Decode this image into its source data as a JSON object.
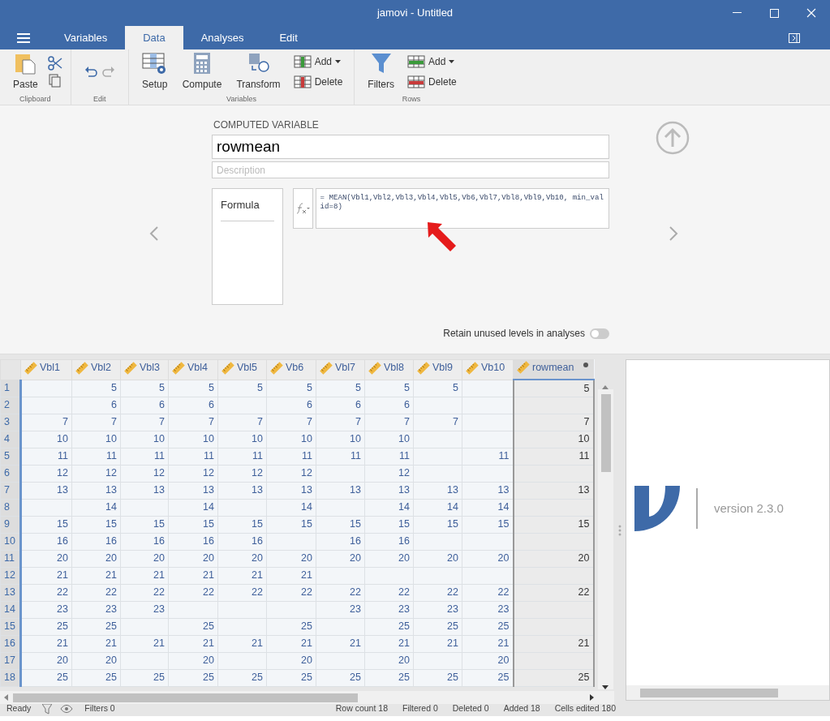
{
  "window": {
    "title": "jamovi - Untitled"
  },
  "tabs": [
    {
      "label": "Variables",
      "selected": false
    },
    {
      "label": "Data",
      "selected": true
    },
    {
      "label": "Analyses",
      "selected": false
    },
    {
      "label": "Edit",
      "selected": false
    }
  ],
  "ribbon": [
    {
      "label": "Clipboard",
      "items": [
        {
          "kind": "paste",
          "label": "Paste"
        },
        {
          "kind": "cutcopy"
        }
      ]
    },
    {
      "label": "Edit",
      "items": [
        {
          "kind": "undoredo"
        }
      ]
    },
    {
      "label": "Variables",
      "items": [
        {
          "kind": "setup",
          "label": "Setup"
        },
        {
          "kind": "compute",
          "label": "Compute"
        },
        {
          "kind": "transform",
          "label": "Transform"
        },
        {
          "kind": "addcol",
          "label": "Add",
          "delete_label": "Delete"
        }
      ]
    },
    {
      "label": "Rows",
      "items": [
        {
          "kind": "filters",
          "label": "Filters"
        },
        {
          "kind": "addrow",
          "label": "Add",
          "delete_label": "Delete"
        }
      ]
    }
  ],
  "computed": {
    "heading": "COMPUTED VARIABLE",
    "name": "rowmean",
    "description": {
      "placeholder": "Description"
    },
    "formula_tab": "Formula",
    "formula": "= MEAN(Vbl1,Vbl2,Vbl3,Vbl4,Vbl5,Vb6,Vbl7,Vbl8,Vbl9,Vb10, min_valid=8)",
    "retain": {
      "label": "Retain unused levels in analyses",
      "on": false
    }
  },
  "grid": {
    "columns": [
      {
        "name": "Vbl1",
        "computed": false,
        "selected": false
      },
      {
        "name": "Vbl2",
        "computed": false,
        "selected": false
      },
      {
        "name": "Vbl3",
        "computed": false,
        "selected": false
      },
      {
        "name": "Vbl4",
        "computed": false,
        "selected": false
      },
      {
        "name": "Vbl5",
        "computed": false,
        "selected": false
      },
      {
        "name": "Vb6",
        "computed": false,
        "selected": false
      },
      {
        "name": "Vbl7",
        "computed": false,
        "selected": false
      },
      {
        "name": "Vbl8",
        "computed": false,
        "selected": false
      },
      {
        "name": "Vbl9",
        "computed": false,
        "selected": false
      },
      {
        "name": "Vb10",
        "computed": false,
        "selected": false
      },
      {
        "name": "rowmean",
        "computed": true,
        "selected": true
      }
    ],
    "rows": [
      {
        "n": "1",
        "cells": [
          "",
          "5",
          "5",
          "5",
          "5",
          "5",
          "5",
          "5",
          "5",
          "",
          "5"
        ]
      },
      {
        "n": "2",
        "cells": [
          "",
          "6",
          "6",
          "6",
          "",
          "6",
          "6",
          "6",
          "",
          "",
          ""
        ]
      },
      {
        "n": "3",
        "cells": [
          "7",
          "7",
          "7",
          "7",
          "7",
          "7",
          "7",
          "7",
          "7",
          "",
          "7"
        ]
      },
      {
        "n": "4",
        "cells": [
          "10",
          "10",
          "10",
          "10",
          "10",
          "10",
          "10",
          "10",
          "",
          "",
          "10"
        ]
      },
      {
        "n": "5",
        "cells": [
          "11",
          "11",
          "11",
          "11",
          "11",
          "11",
          "11",
          "11",
          "",
          "11",
          "11"
        ]
      },
      {
        "n": "6",
        "cells": [
          "12",
          "12",
          "12",
          "12",
          "12",
          "12",
          "",
          "12",
          "",
          "",
          ""
        ]
      },
      {
        "n": "7",
        "cells": [
          "13",
          "13",
          "13",
          "13",
          "13",
          "13",
          "13",
          "13",
          "13",
          "13",
          "13"
        ]
      },
      {
        "n": "8",
        "cells": [
          "",
          "14",
          "",
          "14",
          "",
          "14",
          "",
          "14",
          "14",
          "14",
          ""
        ]
      },
      {
        "n": "9",
        "cells": [
          "15",
          "15",
          "15",
          "15",
          "15",
          "15",
          "15",
          "15",
          "15",
          "15",
          "15"
        ]
      },
      {
        "n": "10",
        "cells": [
          "16",
          "16",
          "16",
          "16",
          "16",
          "",
          "16",
          "16",
          "",
          "",
          ""
        ]
      },
      {
        "n": "11",
        "cells": [
          "20",
          "20",
          "20",
          "20",
          "20",
          "20",
          "20",
          "20",
          "20",
          "20",
          "20"
        ]
      },
      {
        "n": "12",
        "cells": [
          "21",
          "21",
          "21",
          "21",
          "21",
          "21",
          "",
          "",
          "",
          "",
          ""
        ]
      },
      {
        "n": "13",
        "cells": [
          "22",
          "22",
          "22",
          "22",
          "22",
          "22",
          "22",
          "22",
          "22",
          "22",
          "22"
        ]
      },
      {
        "n": "14",
        "cells": [
          "23",
          "23",
          "23",
          "",
          "",
          "",
          "23",
          "23",
          "23",
          "23",
          ""
        ]
      },
      {
        "n": "15",
        "cells": [
          "25",
          "25",
          "",
          "25",
          "",
          "25",
          "",
          "25",
          "25",
          "25",
          ""
        ]
      },
      {
        "n": "16",
        "cells": [
          "21",
          "21",
          "21",
          "21",
          "21",
          "21",
          "21",
          "21",
          "21",
          "21",
          "21"
        ]
      },
      {
        "n": "17",
        "cells": [
          "20",
          "20",
          "",
          "20",
          "",
          "20",
          "",
          "20",
          "",
          "20",
          ""
        ]
      },
      {
        "n": "18",
        "cells": [
          "25",
          "25",
          "25",
          "25",
          "25",
          "25",
          "25",
          "25",
          "25",
          "25",
          "25"
        ]
      }
    ]
  },
  "results": {
    "version": "version 2.3.0"
  },
  "status_bar": {
    "state": "Ready",
    "filters": "Filters 0",
    "row_count": "Row count 18",
    "filtered": "Filtered 0",
    "deleted": "Deleted 0",
    "added": "Added 18",
    "cells_edited": "Cells edited 180"
  }
}
